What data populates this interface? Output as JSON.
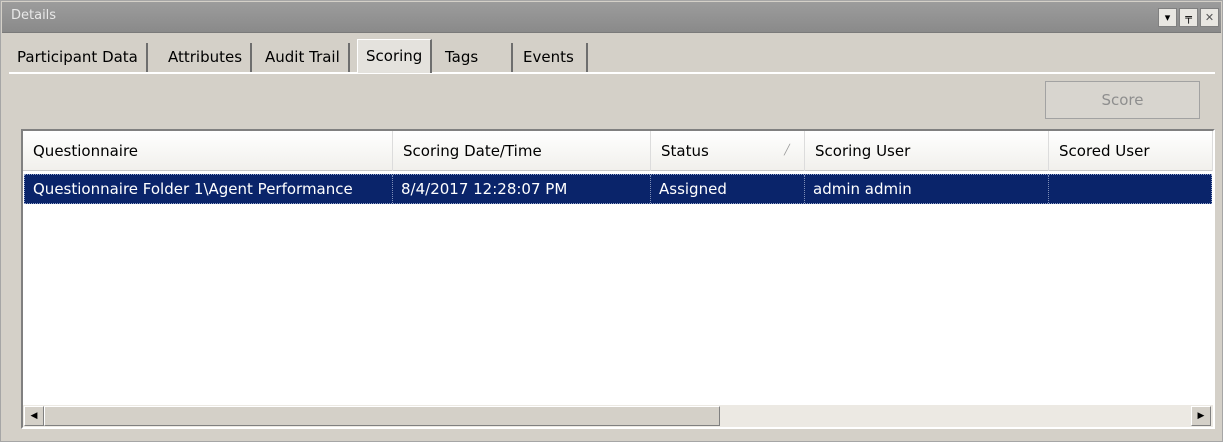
{
  "window": {
    "title": "Details",
    "buttons": {
      "dropdown": "▾",
      "pin": "╤",
      "close": "✕"
    }
  },
  "tabs": [
    {
      "label": "Participant Data"
    },
    {
      "label": "Attributes"
    },
    {
      "label": "Audit Trail"
    },
    {
      "label": "Scoring",
      "active": true
    },
    {
      "label": "Tags"
    },
    {
      "label": "Events"
    }
  ],
  "toolbar": {
    "score_label": "Score"
  },
  "grid": {
    "columns": [
      "Questionnaire",
      "Scoring Date/Time",
      "Status",
      "Scoring User",
      "Scored User"
    ],
    "sort_column": "Status",
    "rows": [
      {
        "questionnaire": "Questionnaire Folder 1\\Agent Performance",
        "scoring_datetime": "8/4/2017 12:28:07 PM",
        "status": "Assigned",
        "scoring_user": "admin admin",
        "scored_user": ""
      }
    ]
  },
  "colors": {
    "selection": "#0a246a",
    "panel": "#d4d0c8"
  }
}
